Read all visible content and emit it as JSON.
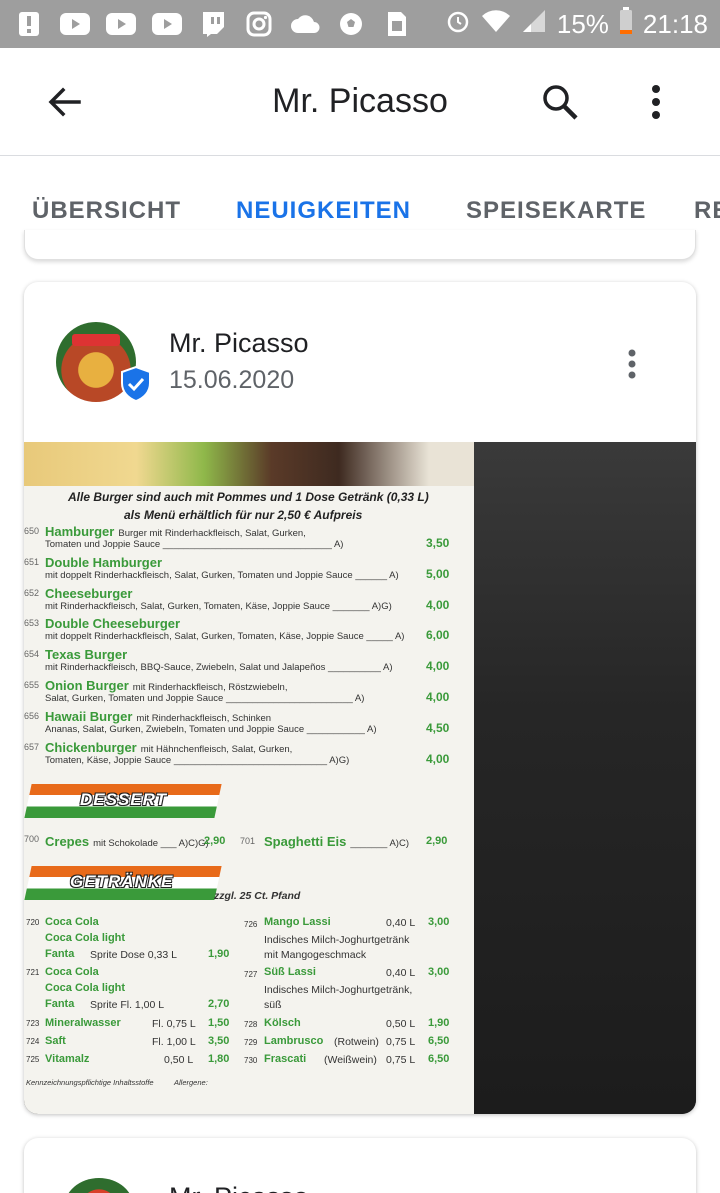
{
  "status_bar": {
    "battery": "15%",
    "time": "21:18",
    "icons": [
      "alert-icon",
      "youtube-icon",
      "youtube-icon",
      "youtube-icon",
      "twitch-icon",
      "instagram-icon",
      "cloud-icon",
      "soccer-icon",
      "sim-icon",
      "alarm-icon",
      "wifi-icon",
      "signal-icon",
      "battery-icon"
    ]
  },
  "app_bar": {
    "title": "Mr. Picasso"
  },
  "tabs": [
    {
      "label": "ÜBERSICHT",
      "active": false
    },
    {
      "label": "NEUIGKEITEN",
      "active": true
    },
    {
      "label": "SPEISEKARTE",
      "active": false
    },
    {
      "label": "RE",
      "active": false
    }
  ],
  "post": {
    "author": "Mr. Picasso",
    "date": "15.06.2020",
    "menu_image": {
      "header_line1": "Alle Burger sind auch mit Pommes und 1 Dose Getränk (0,33 L)",
      "header_line2": "als Menü erhältlich für nur 2,50 € Aufpreis",
      "items": [
        {
          "num": "650",
          "name": "Hamburger",
          "desc1": "Burger mit Rinderhackfleisch, Salat, Gurken,",
          "desc2": "Tomaten und Joppie Sauce ________________________________ A)",
          "price": "3,50"
        },
        {
          "num": "651",
          "name": "Double Hamburger",
          "desc1": "",
          "desc2": "mit doppelt Rinderhackfleisch, Salat, Gurken, Tomaten und Joppie Sauce ______ A)",
          "price": "5,00"
        },
        {
          "num": "652",
          "name": "Cheeseburger",
          "desc1": "",
          "desc2": "mit Rinderhackfleisch, Salat, Gurken, Tomaten, Käse, Joppie Sauce _______ A)G)",
          "price": "4,00"
        },
        {
          "num": "653",
          "name": "Double Cheeseburger",
          "desc1": "",
          "desc2": "mit doppelt Rinderhackfleisch, Salat, Gurken, Tomaten, Käse, Joppie Sauce _____ A)",
          "price": "6,00"
        },
        {
          "num": "654",
          "name": "Texas Burger",
          "desc1": "",
          "desc2": "mit Rinderhackfleisch, BBQ-Sauce, Zwiebeln, Salat und Jalapeños __________ A)",
          "price": "4,00"
        },
        {
          "num": "655",
          "name": "Onion Burger",
          "desc1": "mit Rinderhackfleisch, Röstzwiebeln,",
          "desc2": "Salat, Gurken, Tomaten und Joppie Sauce ________________________ A)",
          "price": "4,00"
        },
        {
          "num": "656",
          "name": "Hawaii Burger",
          "desc1": "mit Rinderhackfleisch, Schinken",
          "desc2": "Ananas, Salat, Gurken, Zwiebeln, Tomaten und Joppie Sauce ___________ A)",
          "price": "4,50"
        },
        {
          "num": "657",
          "name": "Chickenburger",
          "desc1": "mit Hähnchenfleisch, Salat, Gurken,",
          "desc2": "Tomaten, Käse, Joppie Sauce _____________________________ A)G)",
          "price": "4,00"
        }
      ],
      "dessert_banner": "DESSERT",
      "dessert_items": [
        {
          "num": "700",
          "name": "Crepes",
          "desc": "mit Schokolade ___ A)C)G)",
          "price": "2,90"
        },
        {
          "num": "701",
          "name": "Spaghetti Eis",
          "desc": "_______ A)C)",
          "price": "2,90"
        }
      ],
      "drinks_banner": "GETRÄNKE",
      "drinks_note": "zzgl. 25 Ct. Pfand",
      "drinks_left": [
        {
          "num": "720",
          "name": "Coca Cola",
          "size": "",
          "price": ""
        },
        {
          "num": "",
          "name": "Coca Cola light",
          "size": "",
          "price": ""
        },
        {
          "num": "",
          "name": "Fanta",
          "size": "Sprite   Dose 0,33 L",
          "price": "1,90"
        },
        {
          "num": "721",
          "name": "Coca Cola",
          "size": "",
          "price": ""
        },
        {
          "num": "",
          "name": "Coca Cola light",
          "size": "",
          "price": ""
        },
        {
          "num": "",
          "name": "Fanta",
          "size": "Sprite   Fl. 1,00 L",
          "price": "2,70"
        },
        {
          "num": "723",
          "name": "Mineralwasser",
          "size": "Fl. 0,75 L",
          "price": "1,50"
        },
        {
          "num": "724",
          "name": "Saft",
          "size": "Fl. 1,00 L",
          "price": "3,50"
        },
        {
          "num": "725",
          "name": "Vitamalz",
          "size": "0,50 L",
          "price": "1,80"
        }
      ],
      "drinks_right": [
        {
          "num": "726",
          "name": "Mango Lassi",
          "desc": "Indisches Milch-Joghurtgetränk mit Mangogeschmack",
          "size": "0,40 L",
          "price": "3,00"
        },
        {
          "num": "727",
          "name": "Süß Lassi",
          "desc": "Indisches Milch-Joghurtgetränk, süß",
          "size": "0,40 L",
          "price": "3,00"
        },
        {
          "num": "728",
          "name": "Kölsch",
          "desc": "",
          "size": "0,50 L",
          "price": "1,90"
        },
        {
          "num": "729",
          "name": "Lambrusco",
          "desc": "(Rotwein)",
          "size": "0,75 L",
          "price": "6,50"
        },
        {
          "num": "730",
          "name": "Frascati",
          "desc": "(Weißwein)",
          "size": "0,75 L",
          "price": "6,50"
        }
      ],
      "footer_left": "Kennzeichnungspflichtige Inhaltsstoffe",
      "footer_right": "Allergene:"
    }
  },
  "next_post": {
    "author": "Mr. Picasso"
  },
  "colors": {
    "accent": "#1a73e8",
    "status_bar": "#9e9e9e",
    "menu_green": "#3a9a3a"
  }
}
